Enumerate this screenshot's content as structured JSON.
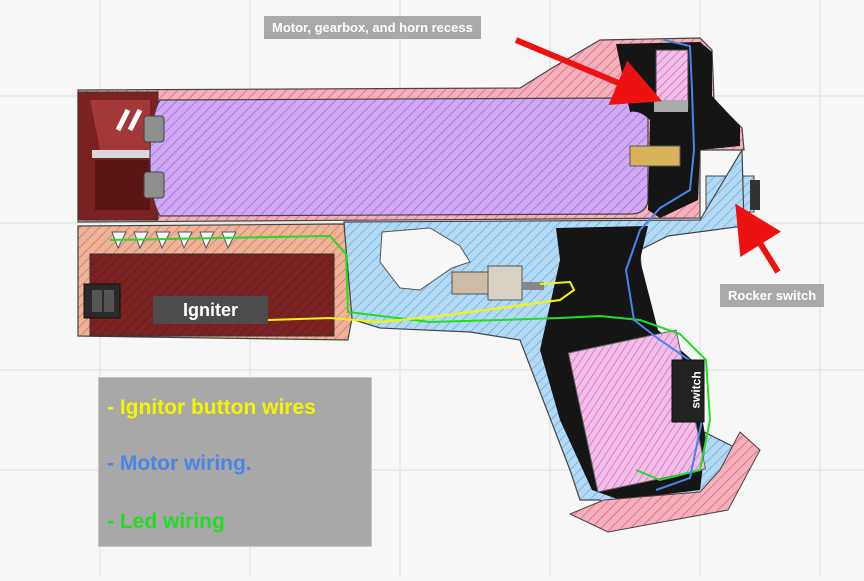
{
  "callouts": {
    "motor_gearbox": "Motor, gearbox, and horn recess",
    "rocker_switch": "Rocker switch",
    "igniter": "Igniter",
    "switch": "switch"
  },
  "legend": {
    "items": [
      {
        "text": "-  Ignitor button wires",
        "color": "#f5f500"
      },
      {
        "text": "-  Motor wiring.",
        "color": "#4a86e8"
      },
      {
        "text": "-  Led wiring",
        "color": "#22dd22"
      }
    ]
  },
  "colors": {
    "background": "#f7f7f7",
    "grid": "#dedede",
    "pink_body": "#f2a7b4",
    "purple_cylinder": "#c9a2f0",
    "blue_frame": "#a9d4f2",
    "dark_red": "#7a2222",
    "salmon": "#e8a890",
    "black_housing": "#141414",
    "arrow": "#ee1111"
  }
}
